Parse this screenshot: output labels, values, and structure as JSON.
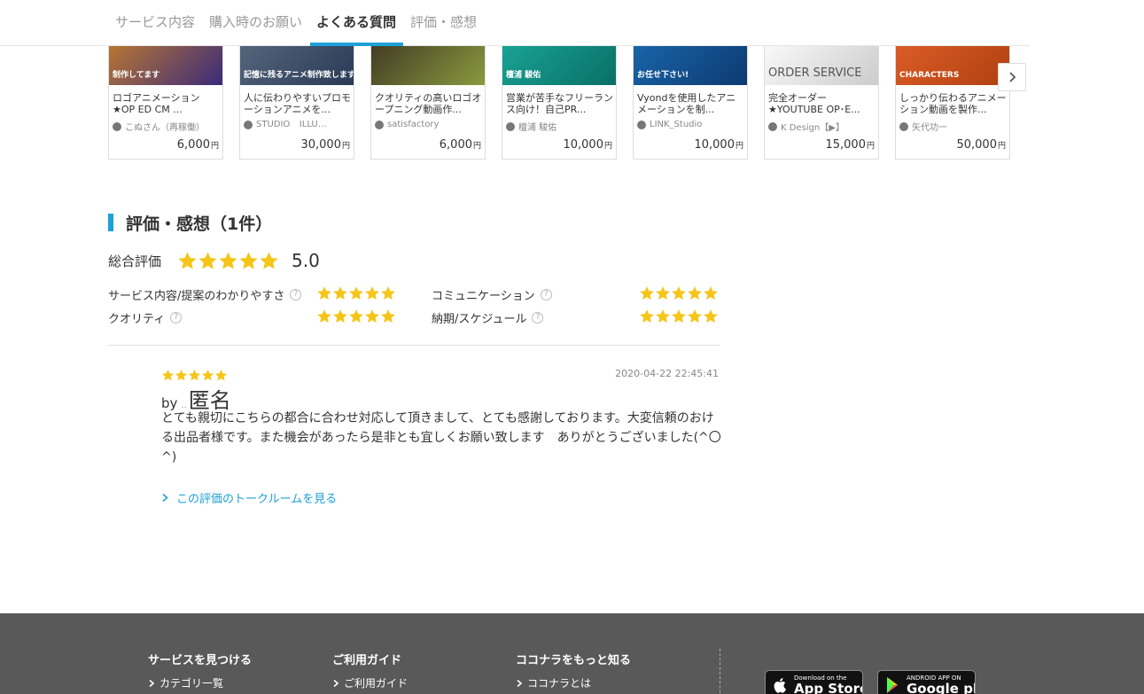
{
  "tabs": [
    {
      "label": "サービス内容",
      "active": false
    },
    {
      "label": "購入時のお願い",
      "active": false
    },
    {
      "label": "よくある質問",
      "active": true
    },
    {
      "label": "評価・感想",
      "active": false
    }
  ],
  "related_services": [
    {
      "title": "ロゴアニメーション★OP ED CM ...",
      "seller": "こぬさん（再稼働）",
      "price": "6,000",
      "yen": "円",
      "thumb_text": "制作してます",
      "thumb_color": "#c8802a",
      "thumb_accent": "#3a2a7a"
    },
    {
      "title": "人に伝わりやすいプロモーションアニメを...",
      "seller": "STUDIO ⠀ILLU…",
      "price": "30,000",
      "yen": "円",
      "thumb_text": "記憶に残るアニメ制作致します",
      "thumb_color": "#5a6a80",
      "thumb_accent": "#2a3a55"
    },
    {
      "title": "クオリティの高いロゴオープニング動画作...",
      "seller": "satisfactory",
      "price": "6,000",
      "yen": "円",
      "thumb_text": "",
      "thumb_color": "#3a3020",
      "thumb_accent": "#8a9a40"
    },
    {
      "title": "営業が苦手なフリーランス向け！自己PR...",
      "seller": "檀浦 駿佑",
      "price": "10,000",
      "yen": "円",
      "thumb_text": "檀浦 駿佑",
      "thumb_color": "#1aa99a",
      "thumb_accent": "#0a6f66"
    },
    {
      "title": "Vyondを使用したアニメーションを制...",
      "seller": "LINK_Studio",
      "price": "10,000",
      "yen": "円",
      "thumb_text": "お任せ下さい!",
      "thumb_color": "#1a6ab0",
      "thumb_accent": "#0d3a70"
    },
    {
      "title": "完全オーダー★YOUTUBE OP･E...",
      "seller": "K Design【▶】",
      "price": "15,000",
      "yen": "円",
      "thumb_text": "ORDER SERVICE",
      "thumb_color": "#ffffff",
      "thumb_accent": "#cccccc"
    },
    {
      "title": "しっかり伝わるアニメーション動画を製作...",
      "seller": "矢代功一",
      "price": "50,000",
      "yen": "円",
      "thumb_text": "CHARACTERS",
      "thumb_color": "#e0602a",
      "thumb_accent": "#b04010"
    }
  ],
  "next_button_icon": "chevron-right-icon",
  "ratings": {
    "title": "評価・感想（1件）",
    "overall_label": "総合評価",
    "overall_score": "5.0",
    "overall_stars": 5,
    "star_color": "#f5c518",
    "criteria": [
      {
        "label": "サービス内容/提案のわかりやすさ",
        "stars": 5
      },
      {
        "label": "クオリティ",
        "stars": 5
      },
      {
        "label": "コミュニケーション",
        "stars": 5
      },
      {
        "label": "納期/スケジュール",
        "stars": 5
      }
    ],
    "help_symbol": "?"
  },
  "review": {
    "stars": 5,
    "date": "2020-04-22 22:45:41",
    "by": "by",
    "dots": "..",
    "author": "匿名",
    "body": "とても親切にこちらの都合に合わせ対応して頂きまして、とても感謝しております。大変信頼のおける出品者様です。また機会があったら是非とも宜しくお願い致します　ありがとうございました(^〇^)",
    "talk_link": "この評価のトークルームを見る"
  },
  "footer": {
    "columns": [
      {
        "head": "サービスを見つける",
        "items": [
          "カテゴリ一覧"
        ]
      },
      {
        "head": "ご利用ガイド",
        "items": [
          "ご利用ガイド"
        ]
      },
      {
        "head": "ココナラをもっと知る",
        "items": [
          "ココナラとは"
        ]
      }
    ],
    "app_store": {
      "small": "Download on the",
      "big": "App Store"
    },
    "google_play": {
      "small": "ANDROID APP ON",
      "big": "Google play"
    }
  }
}
